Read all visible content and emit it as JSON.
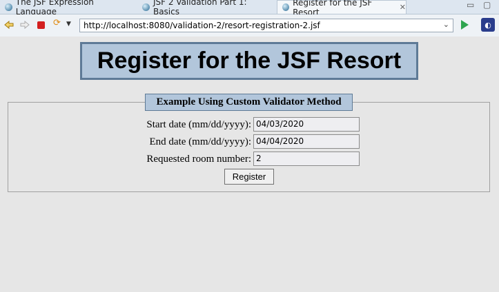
{
  "tabs": [
    {
      "label": "The JSF Expression Language"
    },
    {
      "label": "JSF 2 Validation Part 1: Basics"
    },
    {
      "label": "Register for the JSF Resort"
    }
  ],
  "toolbar": {
    "url": "http://localhost:8080/validation-2/resort-registration-2.jsf"
  },
  "page": {
    "title": "Register for the JSF Resort",
    "legend": "Example Using Custom Validator Method",
    "fields": [
      {
        "label": "Start date (mm/dd/yyyy):",
        "value": "04/03/2020"
      },
      {
        "label": "End date (mm/dd/yyyy):",
        "value": "04/04/2020"
      },
      {
        "label": "Requested room number:",
        "value": "2"
      }
    ],
    "submit_label": "Register"
  }
}
